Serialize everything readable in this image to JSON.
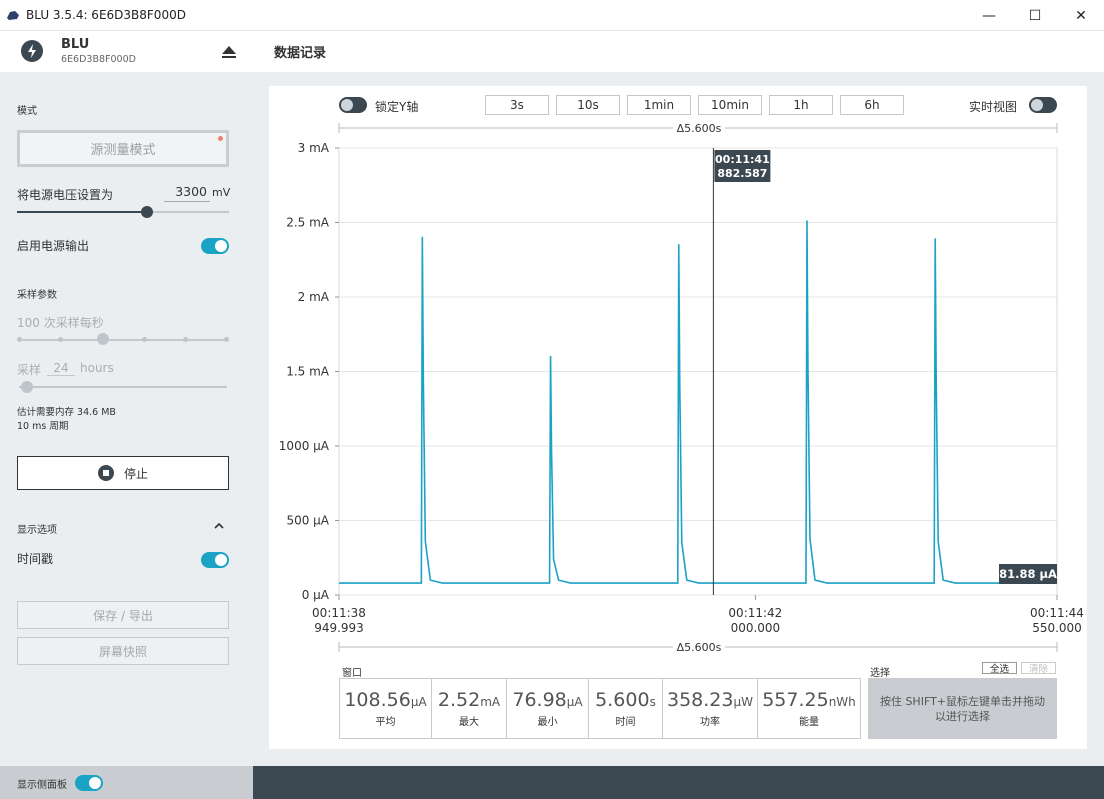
{
  "window": {
    "title": "BLU 3.5.4: 6E6D3B8F000D",
    "minimize": "—",
    "maximize": "☐",
    "close": "✕"
  },
  "device": {
    "name": "BLU",
    "serial": "6E6D3B8F000D"
  },
  "sidebar": {
    "mode_label": "模式",
    "mode_button": "源测量模式",
    "voltage_label": "将电源电压设置为",
    "voltage_value": "3300",
    "voltage_unit": "mV",
    "power_output_label": "启用电源输出",
    "power_output_on": true,
    "sampling_label": "采样参数",
    "sample_rate_label": "100 次采样每秒",
    "sample_prefix": "采样",
    "sample_duration": "24",
    "sample_unit": "hours",
    "memory_estimate": "估计需要内存 34.6 MB",
    "period": "10 ms 周期",
    "stop_button": "停止",
    "display_options_label": "显示选项",
    "timestamp_label": "时间戳",
    "timestamp_on": true,
    "save_export_button": "保存 / 导出",
    "screenshot_button": "屏幕快照",
    "show_sidebar_label": "显示侧面板",
    "show_sidebar_on": true
  },
  "main": {
    "title": "数据记录",
    "lock_y_label": "锁定Y轴",
    "realtime_label": "实时视图",
    "window_buttons": [
      "3s",
      "10s",
      "1min",
      "10min",
      "1h",
      "6h"
    ],
    "delta_top": "Δ5.600s",
    "delta_bottom": "Δ5.600s",
    "cursor_time": "00:11:41",
    "cursor_value": "882.587",
    "current_label": "81.88 μA",
    "stats_title": "窗口",
    "selection_title": "选择",
    "select_all": "全选",
    "clear": "清除",
    "selection_hint": "按住 SHIFT+鼠标左键单击并拖动以进行选择",
    "stats": [
      {
        "value": "108.56",
        "unit": "μA",
        "label": "平均"
      },
      {
        "value": "2.52",
        "unit": "mA",
        "label": "最大"
      },
      {
        "value": "76.98",
        "unit": "μA",
        "label": "最小"
      },
      {
        "value": "5.600",
        "unit": "s",
        "label": "时间"
      },
      {
        "value": "358.23",
        "unit": "μW",
        "label": "功率"
      },
      {
        "value": "557.25",
        "unit": "nWh",
        "label": "能量"
      }
    ]
  },
  "chart_data": {
    "type": "line",
    "y_ticks": [
      "3 mA",
      "2.5 mA",
      "2 mA",
      "1.5 mA",
      "1000 μA",
      "500 μA",
      "0 μA"
    ],
    "ylim": [
      0,
      3
    ],
    "x_ticks": [
      {
        "time": "00:11:38",
        "sub": "949.993"
      },
      {
        "time": "00:11:42",
        "sub": "000.000"
      },
      {
        "time": "00:11:44",
        "sub": "550.000"
      }
    ],
    "xlim": [
      0,
      5.6
    ],
    "baseline_ma": 0.08,
    "spikes": [
      {
        "t": 0.65,
        "peak_ma": 2.4
      },
      {
        "t": 1.65,
        "peak_ma": 1.6
      },
      {
        "t": 2.65,
        "peak_ma": 2.35
      },
      {
        "t": 3.65,
        "peak_ma": 2.51
      },
      {
        "t": 4.65,
        "peak_ma": 2.39
      }
    ],
    "cursor_t": 2.92,
    "colors": {
      "line": "#1aa3c4",
      "grid": "#e4e6e8",
      "label_bg": "#3b4852"
    }
  }
}
